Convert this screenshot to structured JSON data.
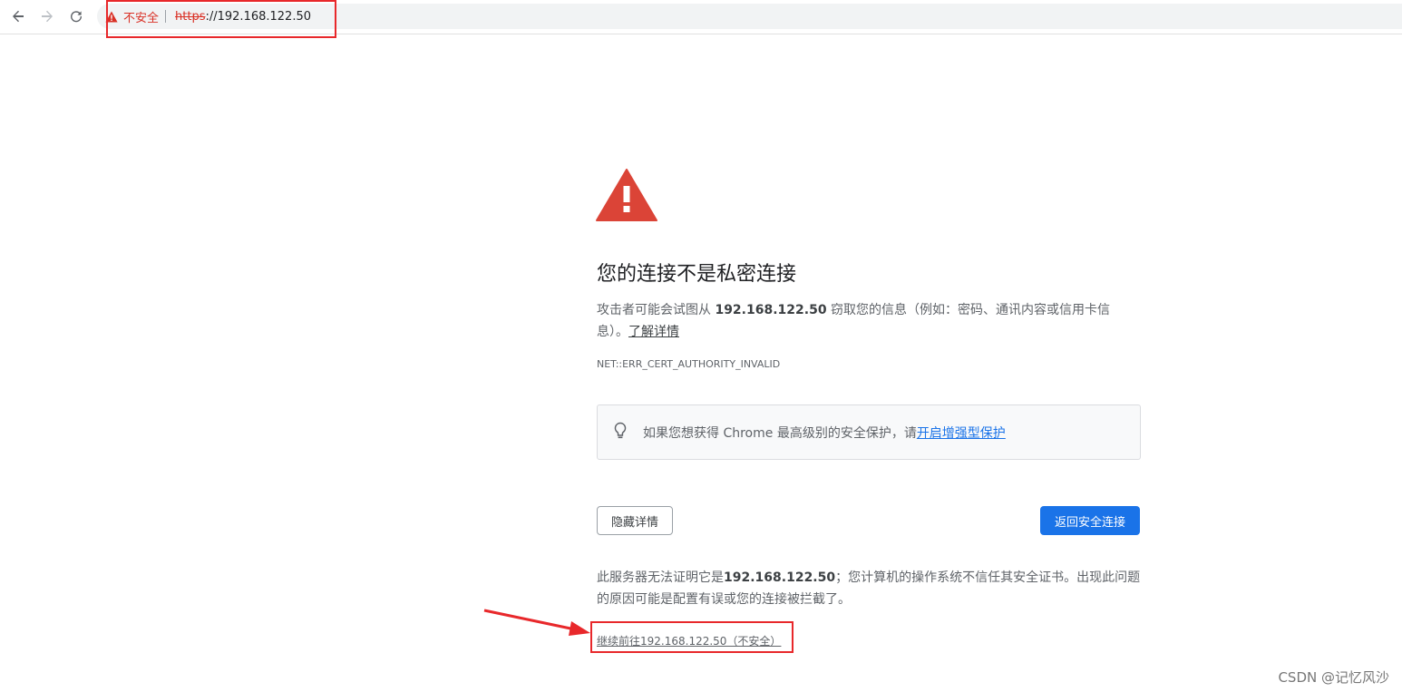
{
  "browser": {
    "security_label": "不安全",
    "url_scheme": "https",
    "url_rest": "://192.168.122.50",
    "icons": [
      "back-arrow-icon",
      "forward-arrow-icon",
      "reload-icon",
      "warning-icon"
    ]
  },
  "interstitial": {
    "title": "您的连接不是私密连接",
    "explanation_pre": "攻击者可能会试图从 ",
    "host": "192.168.122.50",
    "explanation_post": " 窃取您的信息（例如：密码、通讯内容或信用卡信息）。",
    "learn_more": "了解详情",
    "error_code": "NET::ERR_CERT_AUTHORITY_INVALID",
    "enhanced_protection_text": "如果您想获得 Chrome 最高级别的安全保护，请",
    "enhanced_protection_link": "开启增强型保护",
    "hide_details_button": "隐藏详情",
    "back_to_safety_button": "返回安全连接",
    "details_pre": "此服务器无法证明它是",
    "details_host": "192.168.122.50",
    "details_post": "；您计算机的操作系统不信任其安全证书。出现此问题的原因可能是配置有误或您的连接被拦截了。",
    "proceed_link": "继续前往192.168.122.50（不安全）"
  },
  "watermark": "CSDN @记忆风沙",
  "colors": {
    "danger": "#d93025",
    "triangle": "#db4437",
    "primary_button": "#1a73e8",
    "annotation": "#e8282b"
  }
}
